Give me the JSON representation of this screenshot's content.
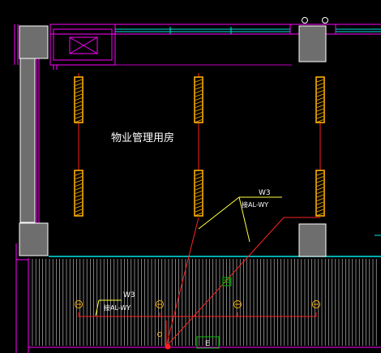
{
  "drawing": {
    "room_label": "物业管理用房",
    "circuits": [
      {
        "id": "W3",
        "panel": "接AL-WY"
      },
      {
        "id": "W3",
        "panel": "接AL-WY"
      }
    ],
    "corridor_tag": "E"
  },
  "colors": {
    "background": "#000000",
    "wall": "#ff00ff",
    "window": "#00e5e5",
    "wire": "#ff2020",
    "fixture": "#ffb000",
    "leader": "#ffff40",
    "text": "#ffffff",
    "column_fill": "#6e6e6e",
    "ground_green": "#00c000"
  }
}
